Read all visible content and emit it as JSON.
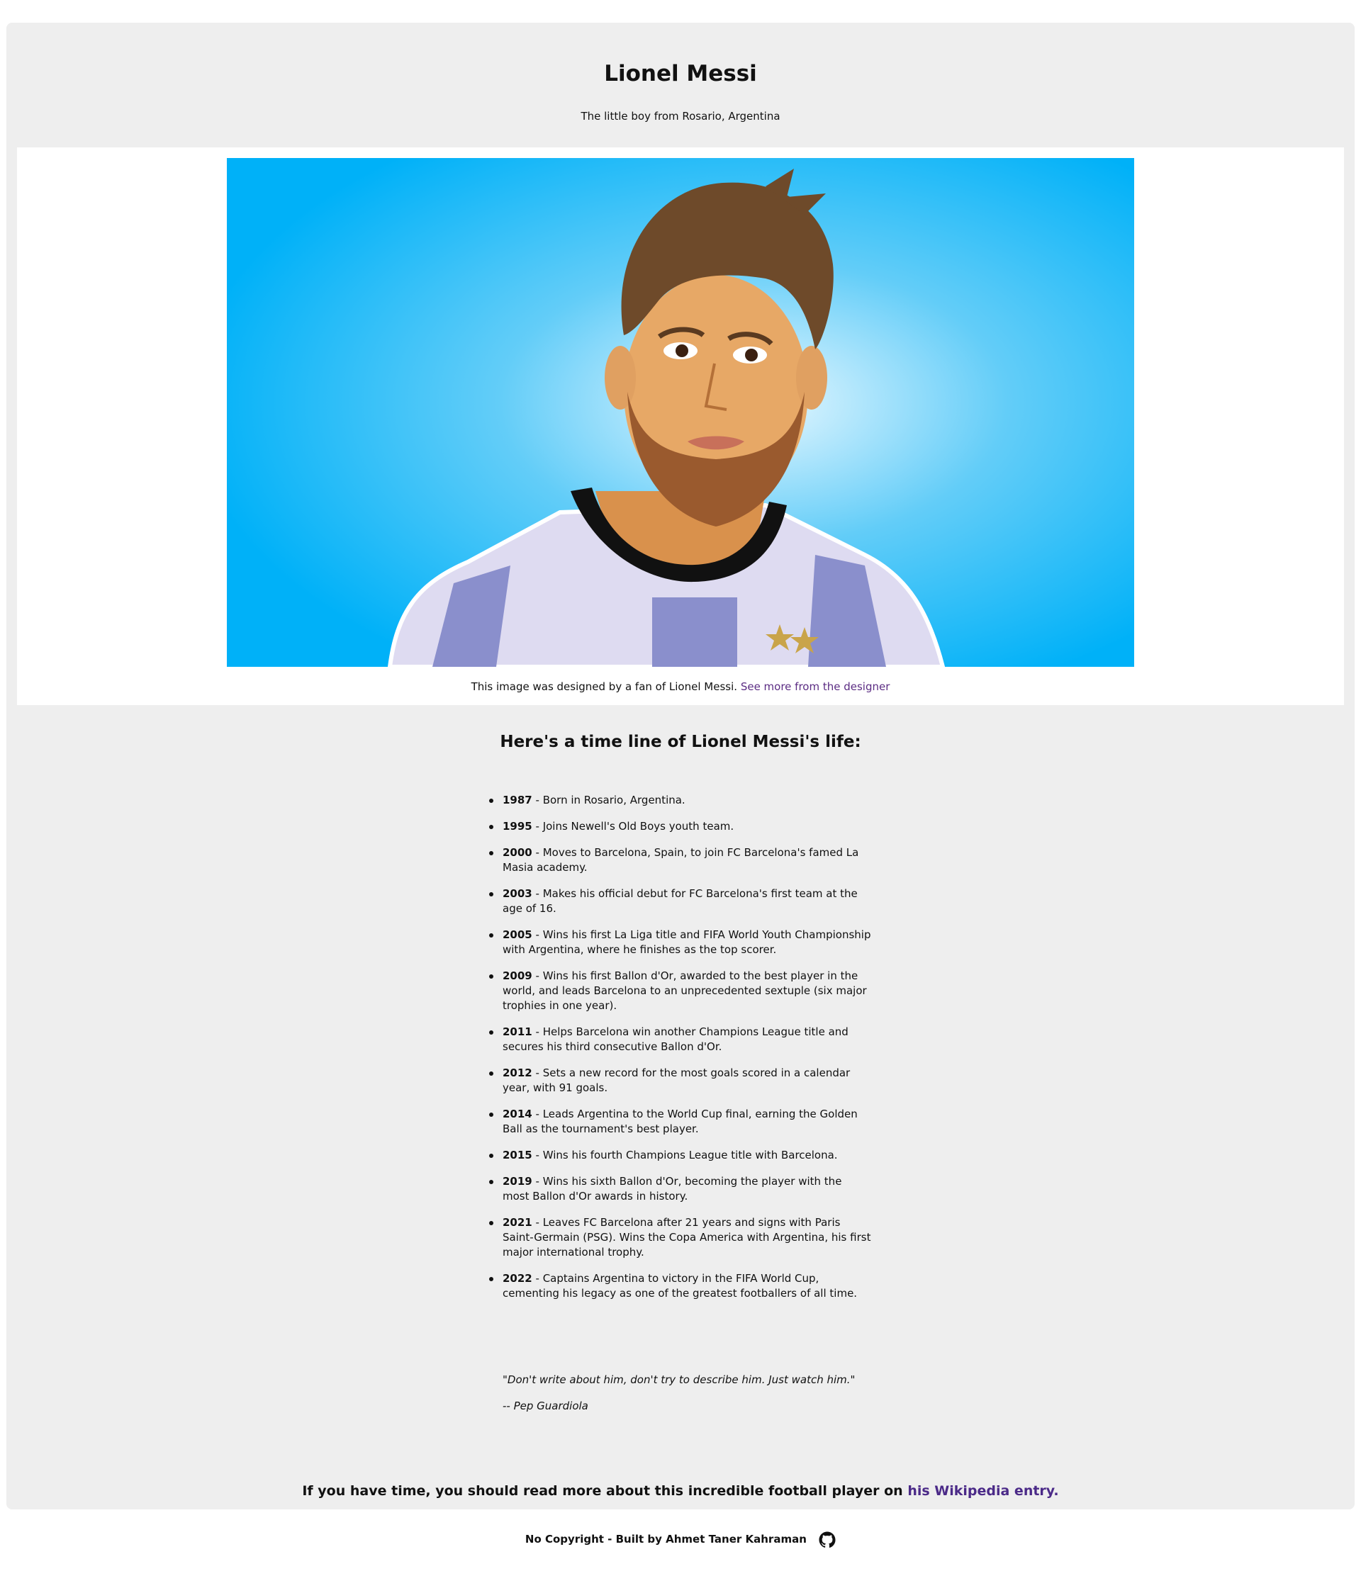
{
  "header": {
    "title": "Lionel Messi",
    "subtitle": "The little boy from Rosario, Argentina"
  },
  "image": {
    "alt": "Illustration of Lionel Messi in an Argentina jersey",
    "caption_prefix": "This image was designed by a fan of Lionel Messi.",
    "caption_link": "See more from the designer",
    "colors": {
      "sky_edge": "#00b1f8",
      "sky_center": "#e9f8ff",
      "jersey_light": "#dedbf1",
      "jersey_stripe": "#8a8fcc",
      "hair": "#6e4a2a",
      "beard": "#9a5a2e",
      "skin": "#e7a866"
    }
  },
  "timeline": {
    "heading": "Here's a time line of Lionel Messi's life:",
    "items": [
      {
        "year": "1987",
        "text": " - Born in Rosario, Argentina."
      },
      {
        "year": "1995",
        "text": " - Joins Newell's Old Boys youth team."
      },
      {
        "year": "2000",
        "text": " - Moves to Barcelona, Spain, to join FC Barcelona's famed La Masia academy."
      },
      {
        "year": "2003",
        "text": " - Makes his official debut for FC Barcelona's first team at the age of 16."
      },
      {
        "year": "2005",
        "text": " - Wins his first La Liga title and FIFA World Youth Championship with Argentina, where he finishes as the top scorer."
      },
      {
        "year": "2009",
        "text": " - Wins his first Ballon d'Or, awarded to the best player in the world, and leads Barcelona to an unprecedented sextuple (six major trophies in one year)."
      },
      {
        "year": "2011",
        "text": " - Helps Barcelona win another Champions League title and secures his third consecutive Ballon d'Or."
      },
      {
        "year": "2012",
        "text": " - Sets a new record for the most goals scored in a calendar year, with 91 goals."
      },
      {
        "year": "2014",
        "text": " - Leads Argentina to the World Cup final, earning the Golden Ball as the tournament's best player."
      },
      {
        "year": "2015",
        "text": " - Wins his fourth Champions League title with Barcelona."
      },
      {
        "year": "2019",
        "text": " - Wins his sixth Ballon d'Or, becoming the player with the most Ballon d'Or awards in history."
      },
      {
        "year": "2021",
        "text": " - Leaves FC Barcelona after 21 years and signs with Paris Saint-Germain (PSG). Wins the Copa America with Argentina, his first major international trophy."
      },
      {
        "year": "2022",
        "text": " - Captains Argentina to victory in the FIFA World Cup, cementing his legacy as one of the greatest footballers of all time."
      }
    ]
  },
  "quote": {
    "text": "\"Don't write about him, don't try to describe him. Just watch him.\"",
    "author": "-- Pep Guardiola"
  },
  "read_more": {
    "prefix": "If you have time, you should read more about this incredible football player on ",
    "link": "his Wikipedia entry."
  },
  "footer": {
    "text": "No Copyright - Built by Ahmet Taner Kahraman",
    "icon": "github-icon"
  }
}
